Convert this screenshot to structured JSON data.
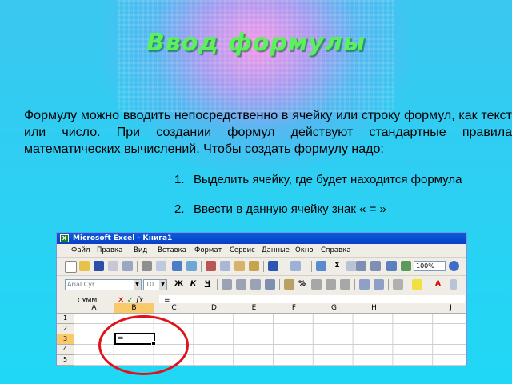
{
  "slide": {
    "title": "Ввод формулы",
    "paragraph": "Формулу можно вводить непосредственно в ячейку или строку формул, как текст или число. При создании формул действуют стандартные правила математических вычислений. Чтобы создать формулу надо:",
    "steps": [
      {
        "num": "1.",
        "text": "Выделить ячейку, где будет находится формула"
      },
      {
        "num": "2.",
        "text": "Ввести в данную ячейку знак « = »"
      }
    ]
  },
  "excel": {
    "window_title": "Microsoft Excel - Книга1",
    "menu": [
      "Файл",
      "Правка",
      "Вид",
      "Вставка",
      "Формат",
      "Сервис",
      "Данные",
      "Окно",
      "Справка"
    ],
    "zoom": "100%",
    "font_name": "Arial Cyr",
    "font_size": "10",
    "name_box": "СУММ",
    "fx_label": "fx",
    "formula_value": "=",
    "columns": [
      "A",
      "B",
      "C",
      "D",
      "E",
      "F",
      "G",
      "H",
      "I",
      "J"
    ],
    "rows": [
      "1",
      "2",
      "3",
      "4",
      "5"
    ],
    "active_cell_value": "=",
    "selected_column": "B",
    "selected_row": "3"
  },
  "colors": {
    "title": "#5cf05a",
    "highlight_circle": "#e0121a",
    "background": "#2fd6f4"
  }
}
